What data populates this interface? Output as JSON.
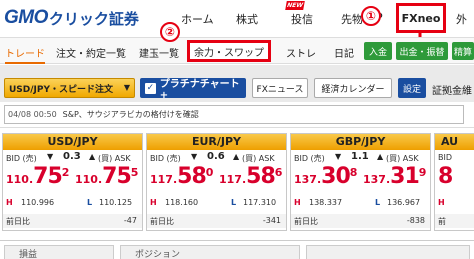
{
  "header": {
    "logo_main": "GMO",
    "logo_sub": "クリック証券",
    "nav": [
      "ホーム",
      "株式",
      "投信",
      "先物",
      "FXneo",
      "外"
    ],
    "new_badge": "NEW",
    "op_fragment": "P",
    "callout1": "①"
  },
  "subnav": {
    "items": [
      "トレード",
      "注文・約定一覧",
      "建玉一覧",
      "余力・スワップ",
      "ストレ",
      "日記"
    ],
    "buttons": [
      "入金",
      "出金・振替",
      "精算"
    ],
    "callout2": "②"
  },
  "toolbar": {
    "pair_select": "USD/JPY・スピード注文",
    "platinum": "プラチナチャート+",
    "fx_news": "FXニュース",
    "calendar": "経済カレンダー",
    "settings": "設定",
    "right_text": "証拠金維"
  },
  "news": {
    "time": "04/08 00:50",
    "text": "S&P、サウジアラビカの格付けを確認"
  },
  "rates": [
    {
      "pair": "USD/JPY",
      "bid_label": "BID (売)",
      "ask_label": "(買) ASK",
      "spread": "0.3",
      "bid_prefix": "110.",
      "bid_main": "75",
      "bid_last": "2",
      "ask_prefix": "110.",
      "ask_main": "75",
      "ask_last": "5",
      "high": "110.996",
      "low": "110.125",
      "change_label": "前日比",
      "change": "-47"
    },
    {
      "pair": "EUR/JPY",
      "bid_label": "BID (売)",
      "ask_label": "(買) ASK",
      "spread": "0.6",
      "bid_prefix": "117.",
      "bid_main": "58",
      "bid_last": "0",
      "ask_prefix": "117.",
      "ask_main": "58",
      "ask_last": "6",
      "high": "118.160",
      "low": "117.310",
      "change_label": "前日比",
      "change": "-341"
    },
    {
      "pair": "GBP/JPY",
      "bid_label": "BID (売)",
      "ask_label": "(買) ASK",
      "spread": "1.1",
      "bid_prefix": "137.",
      "bid_main": "30",
      "bid_last": "8",
      "ask_prefix": "137.",
      "ask_main": "31",
      "ask_last": "9",
      "high": "138.337",
      "low": "136.967",
      "change_label": "前日比",
      "change": "-838"
    },
    {
      "pair": "AU",
      "bid_label": "BID",
      "ask_label": "",
      "spread": "",
      "bid_prefix": "8",
      "bid_main": "",
      "bid_last": "",
      "ask_prefix": "",
      "ask_main": "",
      "ask_last": "",
      "high": "",
      "low": "",
      "change_label": "前",
      "change": ""
    }
  ],
  "bottom": {
    "tab1": "損益",
    "tab2": "ポジション"
  },
  "colors": {
    "brand_blue": "#1a4ea0",
    "callout_red": "#e60012",
    "price_red": "#d8002c",
    "panel_orange": "#f0a800"
  }
}
